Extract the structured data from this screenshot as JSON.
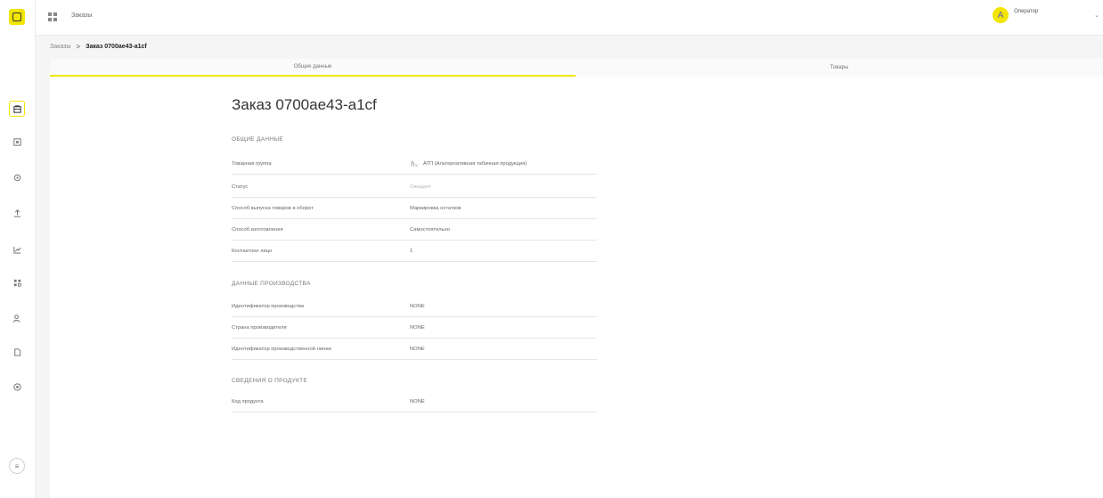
{
  "sidebar": {
    "items": [
      {
        "icon": "orders-icon",
        "active": true
      },
      {
        "icon": "document-icon",
        "active": false
      },
      {
        "icon": "settings-icon",
        "active": false
      },
      {
        "icon": "upload-icon",
        "active": false
      },
      {
        "icon": "chart-icon",
        "active": false
      },
      {
        "icon": "grid-icon",
        "active": false
      },
      {
        "icon": "users-icon",
        "active": false
      },
      {
        "icon": "file-icon",
        "active": false
      },
      {
        "icon": "globe-icon",
        "active": false
      }
    ],
    "collapse_icon": "menu-icon"
  },
  "header": {
    "title": "Заказы",
    "user": {
      "initial": "A",
      "name": "Оператор"
    }
  },
  "breadcrumb": {
    "parent": "Заказы",
    "separator": ">",
    "current": "Заказ 0700ae43-a1cf"
  },
  "tabs": [
    {
      "label": "Общие данные",
      "active": true
    },
    {
      "label": "Товары",
      "active": false
    }
  ],
  "order": {
    "title": "Заказ 0700ae43-a1cf",
    "sections": {
      "general": {
        "title": "ОБЩИЕ ДАННЫЕ",
        "rows": [
          {
            "label": "Товарная группа",
            "value": "АТП (Альтернативная табачная продукция)"
          },
          {
            "label": "Статус",
            "value": "Ожидает"
          },
          {
            "label": "Способ выпуска товаров в оборот",
            "value": "Маркировка остатков"
          },
          {
            "label": "Способ изготовления",
            "value": "Самостоятельно"
          },
          {
            "label": "Контактное лицо",
            "value": "1"
          }
        ]
      },
      "production": {
        "title": "ДАННЫЕ ПРОИЗВОДСТВА",
        "rows": [
          {
            "label": "Идентификатор производства",
            "value": "NONE"
          },
          {
            "label": "Страна производителя",
            "value": "NONE"
          },
          {
            "label": "Идентификатор производственной линии",
            "value": "NONE"
          }
        ]
      },
      "product": {
        "title": "СВЕДЕНИЯ О ПРОДУКТЕ",
        "rows": [
          {
            "label": "Код продукта",
            "value": "NONE"
          }
        ]
      }
    }
  },
  "colors": {
    "accent": "#f2e600",
    "text": "#333333",
    "muted": "#b8b8b8"
  }
}
